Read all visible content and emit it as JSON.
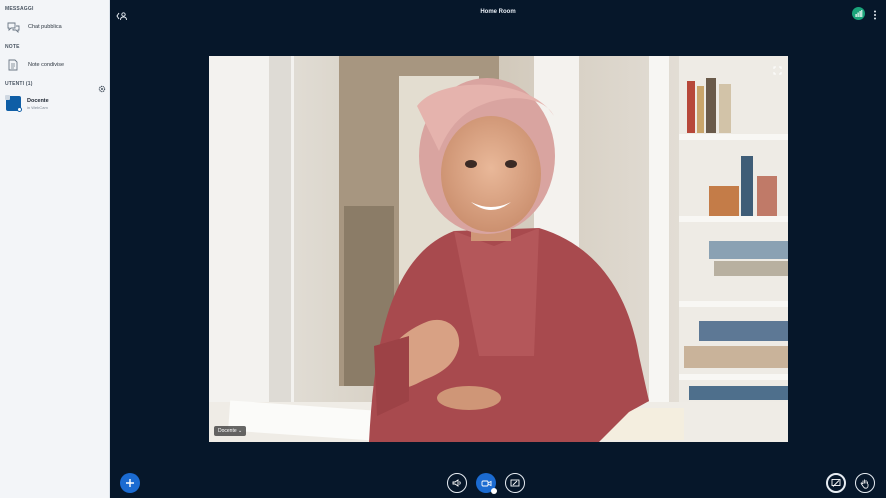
{
  "sidebar": {
    "messages_title": "MESSAGGI",
    "public_chat": "Chat pubblica",
    "notes_title": "NOTE",
    "shared_notes": "Note condivise",
    "users_title": "UTENTI (1)",
    "user": {
      "name": "Docente",
      "subtitle": "in WebCam"
    }
  },
  "header": {
    "room_title": "Home Room"
  },
  "video": {
    "label": "Docente ⌄"
  },
  "colors": {
    "background": "#06172a",
    "accent": "#1b6bd1",
    "connection": "#1aa37a"
  },
  "icons": {
    "collapse": "back-user-icon",
    "chat": "chat-bubbles-icon",
    "notes": "note-icon",
    "settings": "gear-icon",
    "connection": "signal-bars-icon",
    "more": "kebab-icon",
    "expand": "fullscreen-icon",
    "plus": "plus-icon",
    "audio": "speaker-icon",
    "video": "camera-icon",
    "screen": "screen-share-icon",
    "present": "presentation-icon",
    "hand": "raise-hand-icon"
  }
}
